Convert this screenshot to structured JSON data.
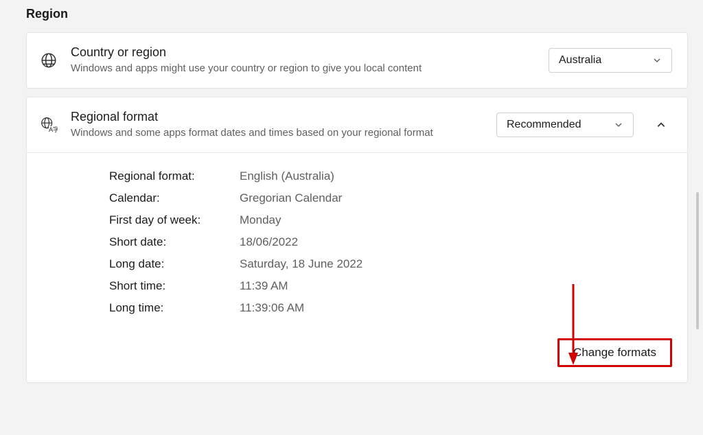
{
  "section_title": "Region",
  "country_card": {
    "title": "Country or region",
    "desc": "Windows and apps might use your country or region to give you local content",
    "selected": "Australia"
  },
  "format_card": {
    "title": "Regional format",
    "desc": "Windows and some apps format dates and times based on your regional format",
    "selected": "Recommended"
  },
  "details": {
    "regional_format_label": "Regional format:",
    "regional_format_value": "English (Australia)",
    "calendar_label": "Calendar:",
    "calendar_value": "Gregorian Calendar",
    "first_day_label": "First day of week:",
    "first_day_value": "Monday",
    "short_date_label": "Short date:",
    "short_date_value": "18/06/2022",
    "long_date_label": "Long date:",
    "long_date_value": "Saturday, 18 June 2022",
    "short_time_label": "Short time:",
    "short_time_value": "11:39 AM",
    "long_time_label": "Long time:",
    "long_time_value": "11:39:06 AM"
  },
  "change_button": "Change formats",
  "colors": {
    "annotation": "#d00000"
  }
}
